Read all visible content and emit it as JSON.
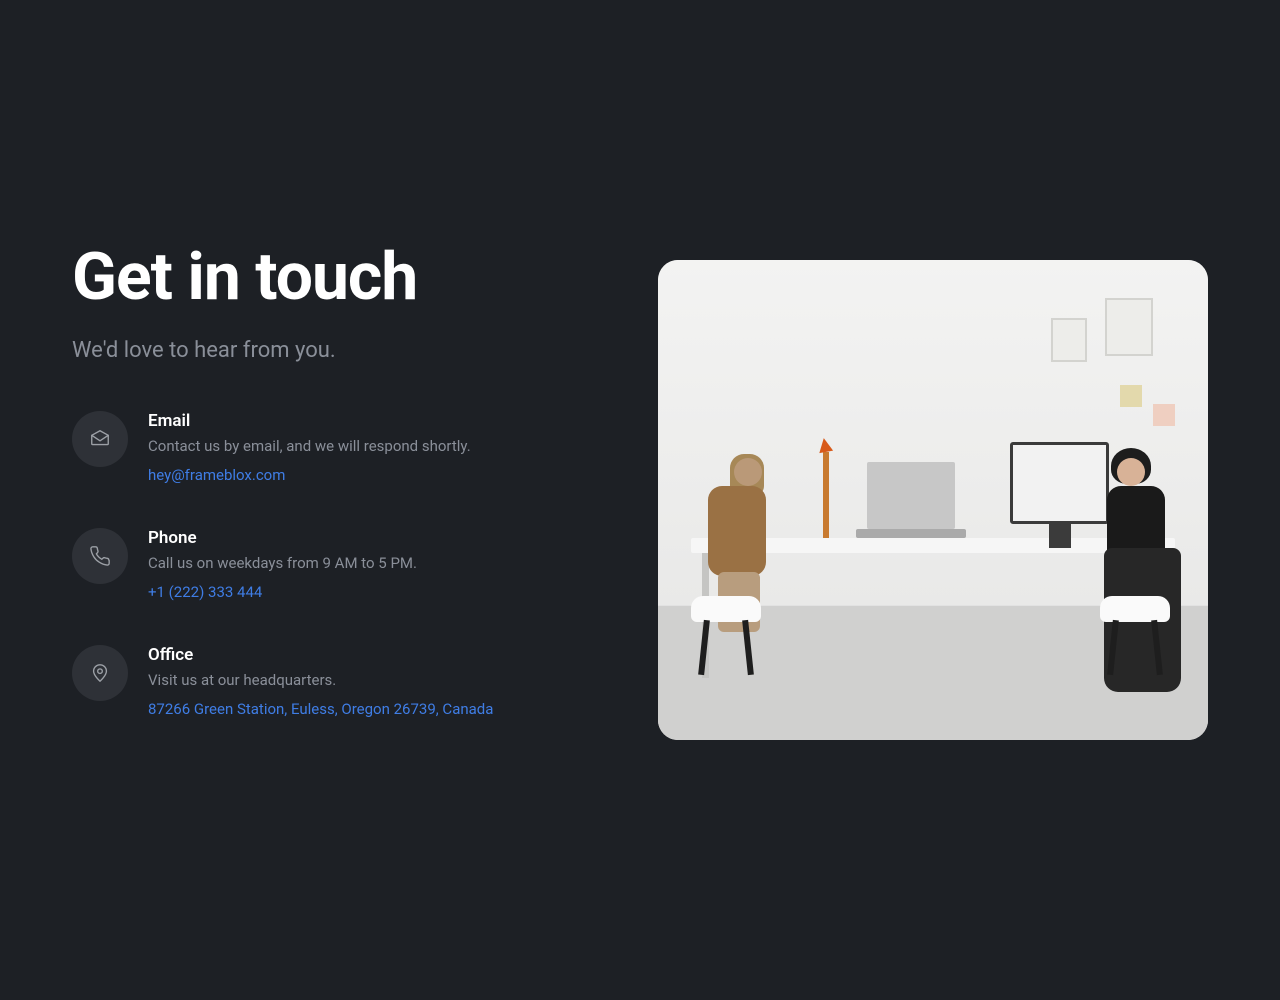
{
  "header": {
    "title": "Get in touch",
    "subtitle": "We'd love to hear from you."
  },
  "contact": [
    {
      "icon": "envelope",
      "title": "Email",
      "description": "Contact us by email, and we will respond shortly.",
      "link_text": "hey@frameblox.com"
    },
    {
      "icon": "phone",
      "title": "Phone",
      "description": "Call us on weekdays from 9 AM to 5 PM.",
      "link_text": "+1 (222) 333 444"
    },
    {
      "icon": "map-pin",
      "title": "Office",
      "description": "Visit us at our headquarters.",
      "link_text": "87266 Green Station, Euless, Oregon 26739, Canada"
    }
  ]
}
